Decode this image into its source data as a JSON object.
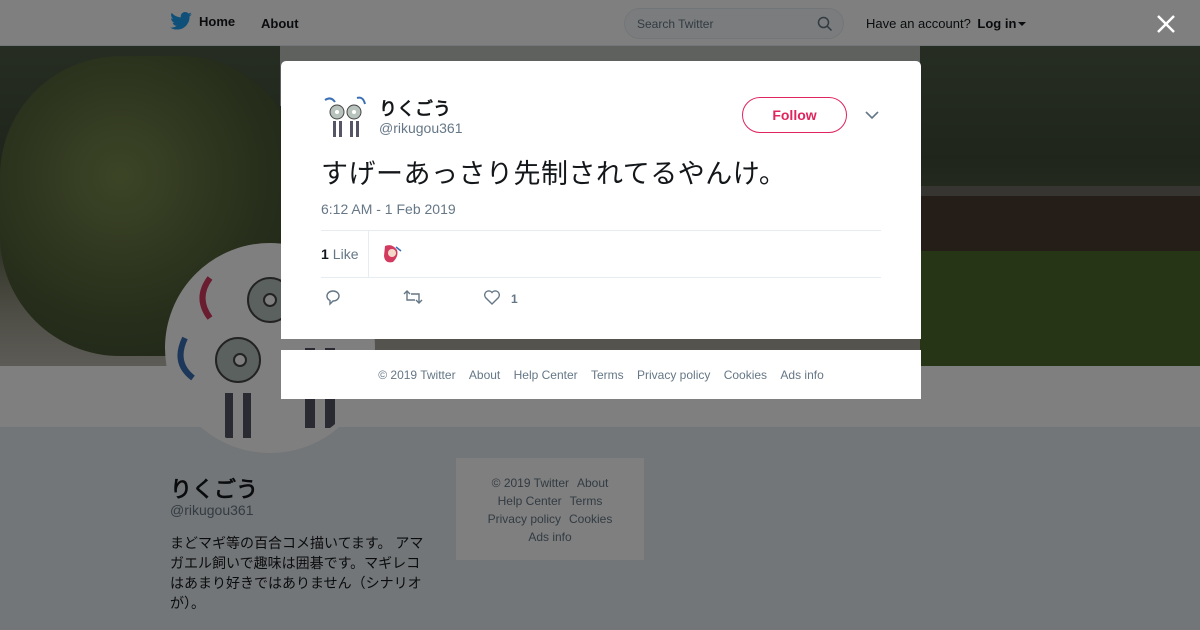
{
  "nav": {
    "home_label": "Home",
    "about_label": "About",
    "search_placeholder": "Search Twitter",
    "account_prompt": "Have an account?",
    "login_label": "Log in"
  },
  "profile": {
    "name": "りくごう",
    "handle": "@rikugou361",
    "bio": "まどマギ等の百合コメ描いてます。 アマガエル飼いで趣味は囲碁です。マギレコはあまり好きではありません（シナリオが）。"
  },
  "side_footer": {
    "copyright": "© 2019 Twitter",
    "about": "About",
    "help": "Help Center",
    "terms": "Terms",
    "privacy": "Privacy policy",
    "cookies": "Cookies",
    "ads": "Ads info"
  },
  "tweet": {
    "author_name": "りくごう",
    "author_handle": "@rikugou361",
    "follow_label": "Follow",
    "text": "すげーあっさり先制されてるやんけ。",
    "timestamp": "6:12 AM - 1 Feb 2019",
    "likes_count": "1",
    "likes_label": "Like",
    "like_action_count": "1"
  },
  "modal_footer": {
    "copyright": "© 2019 Twitter",
    "about": "About",
    "help": "Help Center",
    "terms": "Terms",
    "privacy": "Privacy policy",
    "cookies": "Cookies",
    "ads": "Ads info"
  },
  "colors": {
    "brand_blue": "#1da1f2",
    "follow_red": "#e0245e",
    "secondary_text": "#657786"
  },
  "icons": [
    "twitter-bird-icon",
    "search-icon",
    "close-icon",
    "chevron-down-icon",
    "reply-icon",
    "retweet-icon",
    "heart-icon"
  ]
}
